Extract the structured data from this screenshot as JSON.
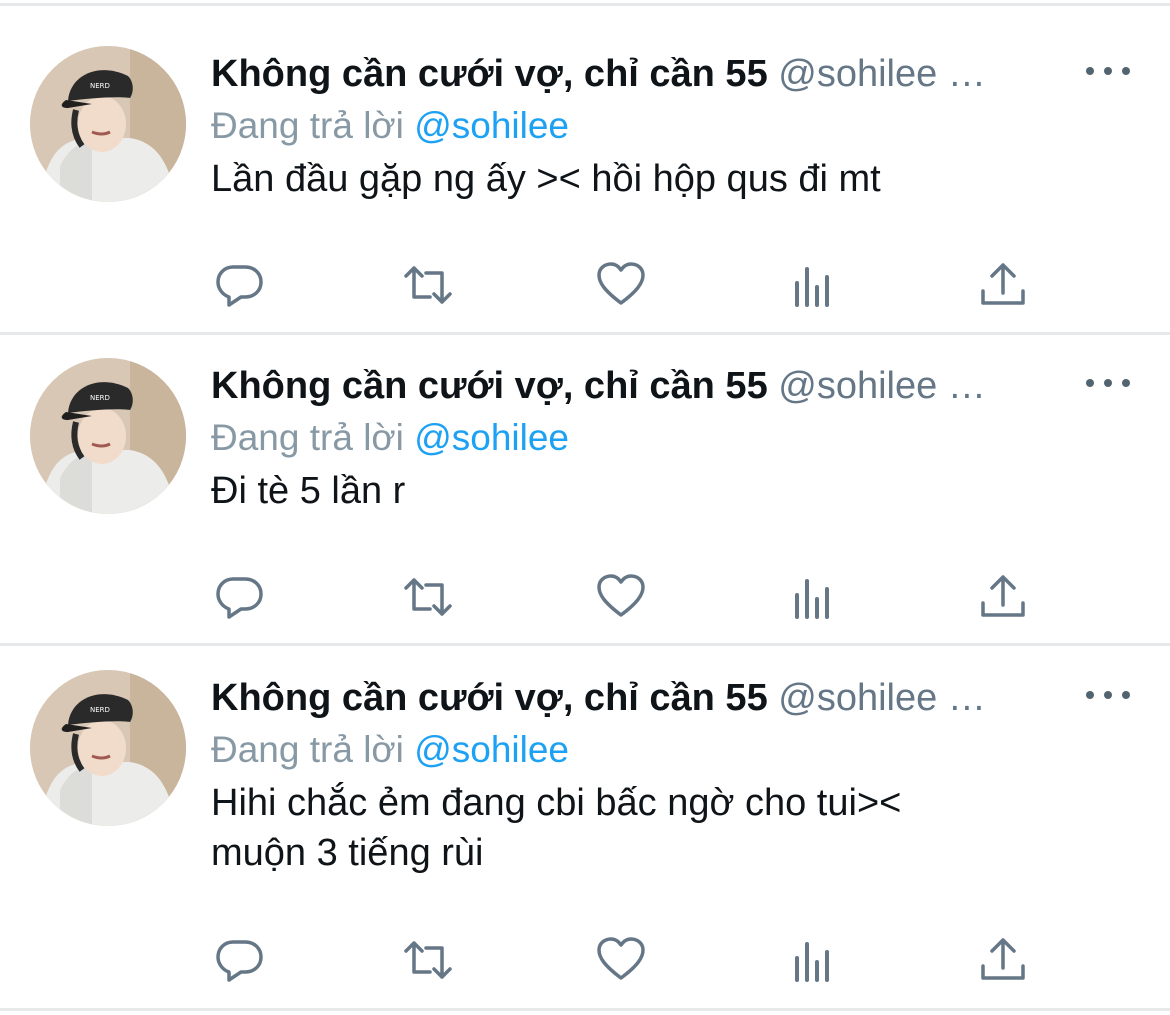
{
  "tweets": [
    {
      "author_name": "Không cần cưới vợ, chỉ cần 55",
      "author_handle": "@sohilee …",
      "reply_prefix": "Đang trả lời ",
      "reply_mention": "@sohilee",
      "lines": [
        "Lần đầu gặp ng ấy >< hồi hộp qus đi mt"
      ]
    },
    {
      "author_name": "Không cần cưới vợ, chỉ cần 55",
      "author_handle": "@sohilee …",
      "reply_prefix": "Đang trả lời ",
      "reply_mention": "@sohilee",
      "lines": [
        "Đi tè 5 lần r"
      ]
    },
    {
      "author_name": "Không cần cưới vợ, chỉ cần 55",
      "author_handle": "@sohilee …",
      "reply_prefix": "Đang trả lời ",
      "reply_mention": "@sohilee",
      "lines": [
        "Hihi chắc ẻm đang cbi bấc ngờ cho tui><",
        "muộn 3 tiếng rùi"
      ]
    }
  ],
  "icons": {
    "reply": "reply-icon",
    "retweet": "retweet-icon",
    "like": "heart-icon",
    "analytics": "analytics-icon",
    "share": "share-icon",
    "more": "more-icon"
  },
  "colors": {
    "name": "#0f1419",
    "handle": "#657786",
    "reply_prefix": "#8899a6",
    "mention": "#1da1f2",
    "icon": "#657786",
    "divider": "#e6e8ea"
  }
}
